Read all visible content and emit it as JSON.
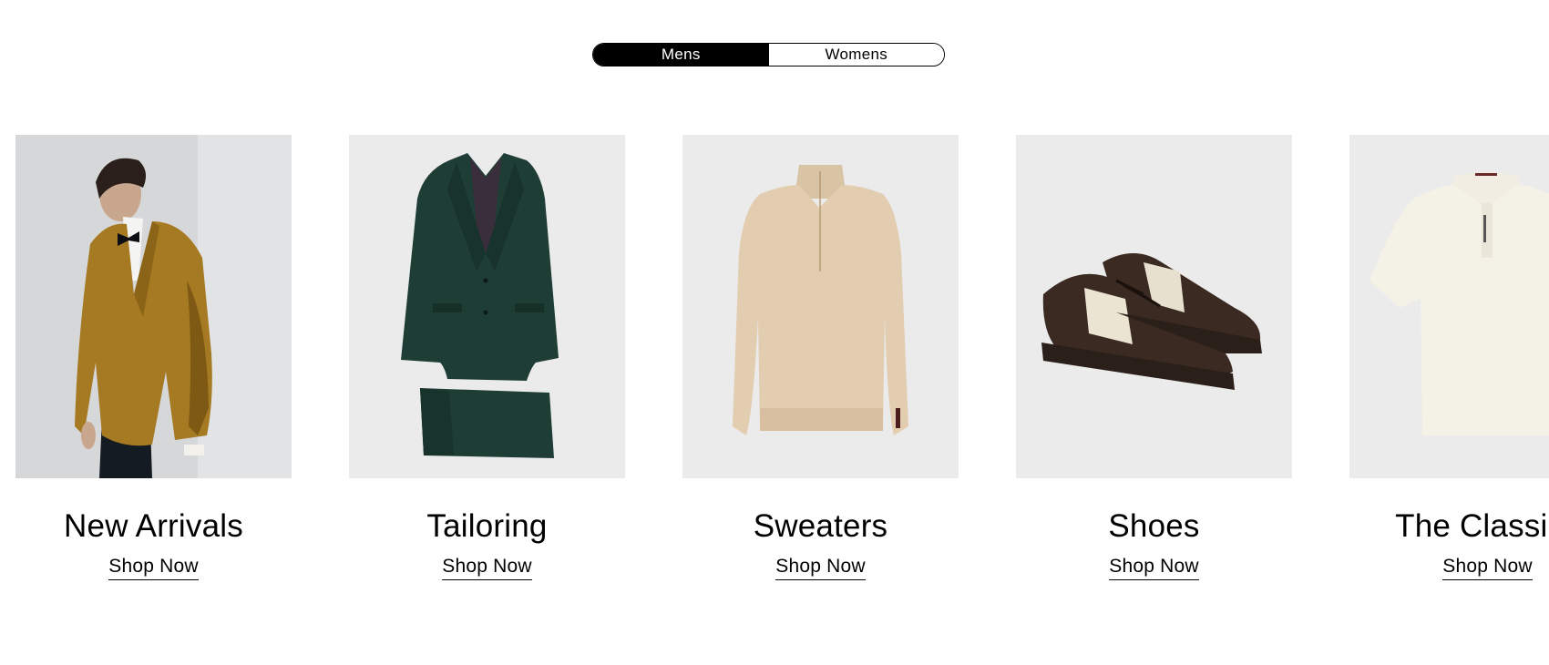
{
  "gender_toggle": {
    "options": [
      {
        "label": "Mens",
        "active": true
      },
      {
        "label": "Womens",
        "active": false
      }
    ]
  },
  "categories": [
    {
      "title": "New Arrivals",
      "link": "Shop Now",
      "image": "man-in-velvet-jacket"
    },
    {
      "title": "Tailoring",
      "link": "Shop Now",
      "image": "green-suit"
    },
    {
      "title": "Sweaters",
      "link": "Shop Now",
      "image": "beige-half-zip-sweater"
    },
    {
      "title": "Shoes",
      "link": "Shop Now",
      "image": "brown-sneakers"
    },
    {
      "title": "The Classics",
      "link": "Shop Now",
      "image": "cream-polo-shirt"
    }
  ],
  "colors": {
    "toggle_active_bg": "#000000",
    "image_bg": "#ebebeb"
  }
}
